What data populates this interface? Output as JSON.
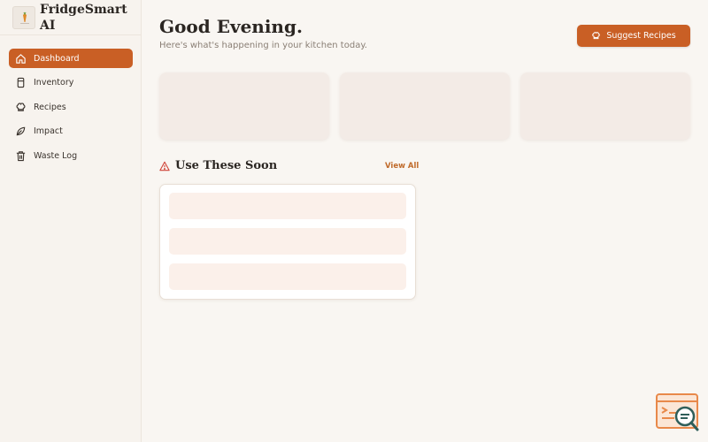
{
  "brand": {
    "name": "FridgeSmart AI",
    "logo_icon": "carrot-icon"
  },
  "sidebar": {
    "items": [
      {
        "label": "Dashboard",
        "icon": "home-icon",
        "active": true
      },
      {
        "label": "Inventory",
        "icon": "jar-icon",
        "active": false
      },
      {
        "label": "Recipes",
        "icon": "chef-hat-icon",
        "active": false
      },
      {
        "label": "Impact",
        "icon": "leaf-icon",
        "active": false
      },
      {
        "label": "Waste Log",
        "icon": "trash-icon",
        "active": false
      }
    ]
  },
  "header": {
    "greeting": "Good Evening.",
    "subtitle": "Here's what's happening in your kitchen today.",
    "suggest_label": "Suggest Recipes",
    "suggest_icon": "chef-hat-icon"
  },
  "section": {
    "title": "Use These Soon",
    "icon": "warning-icon",
    "view_all": "View All"
  },
  "colors": {
    "accent": "#c95f25",
    "background": "#f9f6f2",
    "skeleton": "#f3ebe6",
    "warning": "#d0453a"
  }
}
